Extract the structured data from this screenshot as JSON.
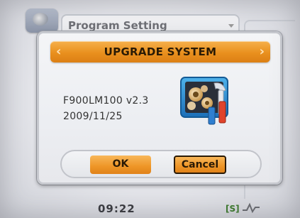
{
  "header": {
    "tab_label": "Program Setting"
  },
  "dialog": {
    "title": "UPGRADE SYSTEM",
    "left_arrow": "‹",
    "right_arrow": "›",
    "version": "F900LM100 v2.3",
    "date": "2009/11/25",
    "ok_label": "OK",
    "cancel_label": "Cancel",
    "icon": "upgrade-tools-icon"
  },
  "status_bar": {
    "time": "09:22",
    "signal_label": "[S]",
    "signal_icon": "signal-icon"
  },
  "colors": {
    "accent": "#ee9526",
    "title_text": "#2a1a05"
  }
}
